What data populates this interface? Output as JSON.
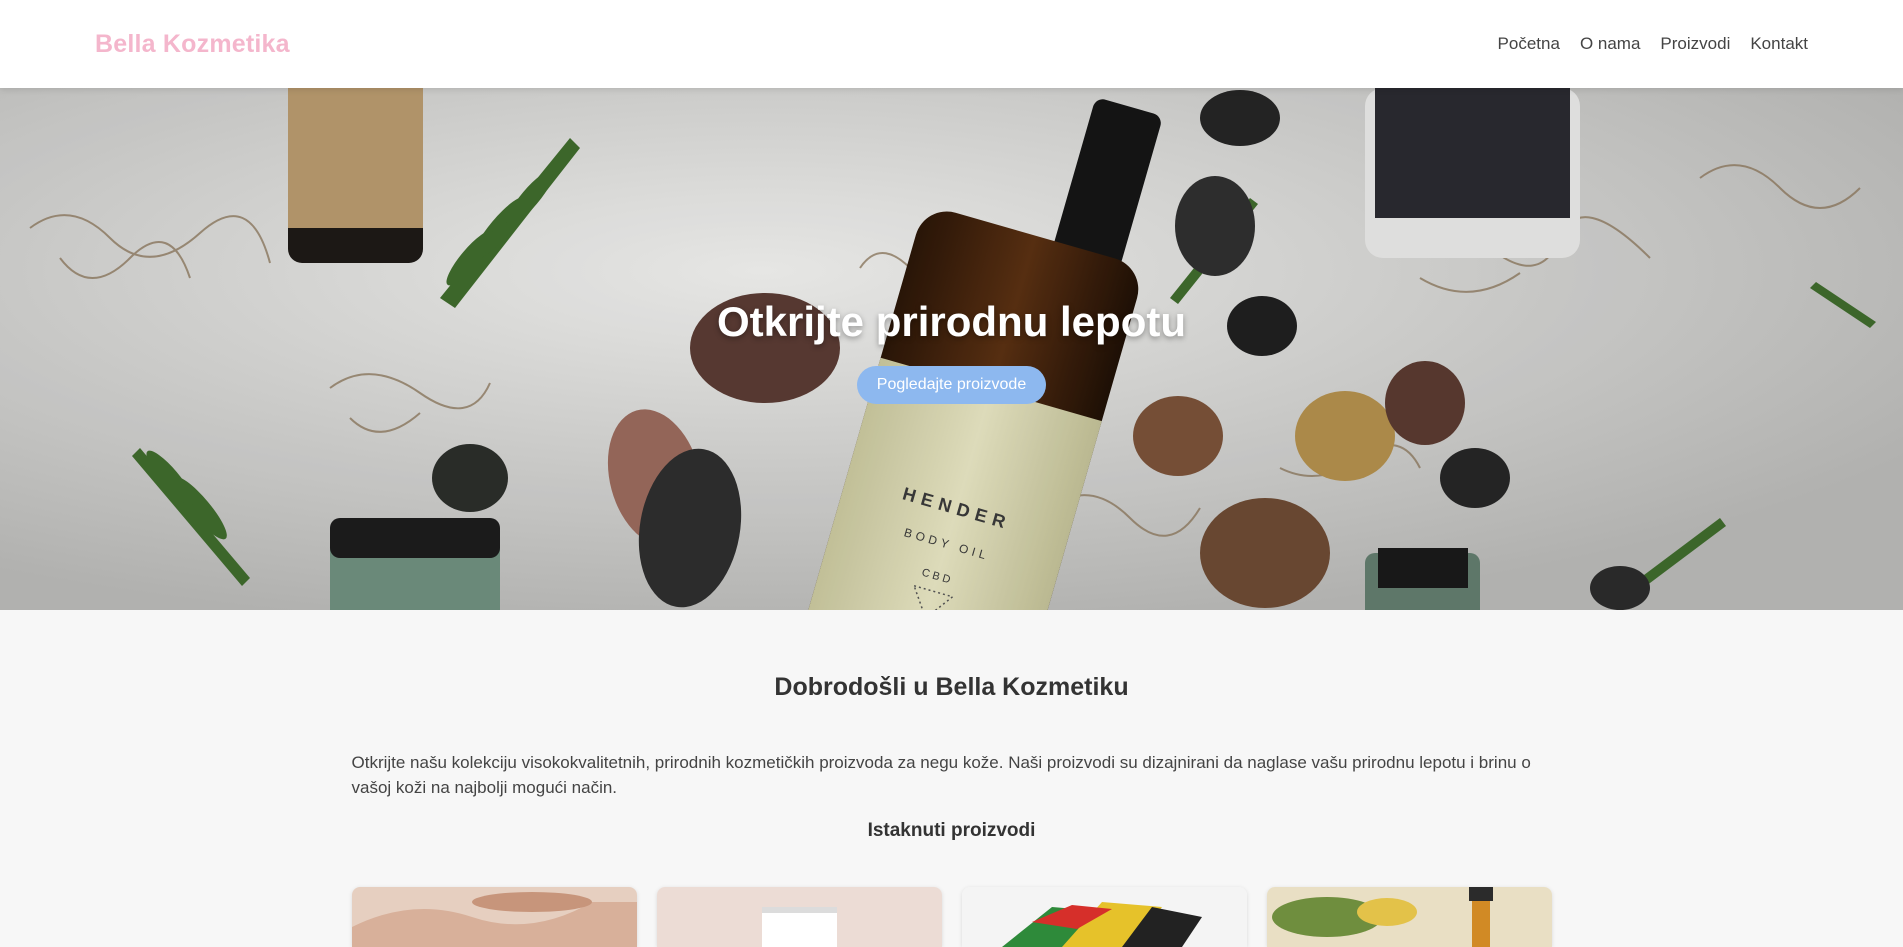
{
  "header": {
    "logo": "Bella Kozmetika",
    "nav": [
      "Početna",
      "O nama",
      "Proizvodi",
      "Kontakt"
    ]
  },
  "hero": {
    "title": "Otkrijte prirodnu lepotu",
    "cta": "Pogledajte proizvode",
    "bottle_label": {
      "brand": "HENDER",
      "product": "BODY OIL",
      "ingredient": "CBD"
    }
  },
  "main": {
    "welcome_title": "Dobrodošli u Bella Kozmetiku",
    "intro": "Otkrijte našu kolekciju visokokvalitetnih, prirodnih kozmetičkih proizvoda za negu kože. Naši proizvodi su dizajnirani da naglase vašu prirodnu lepotu i brinu o vašoj koži na najbolji mogući način.",
    "featured_title": "Istaknuti proizvodi"
  },
  "colors": {
    "logo": "#f4b6cc",
    "cta": "#8db8ef",
    "background": "#f7f7f7"
  }
}
